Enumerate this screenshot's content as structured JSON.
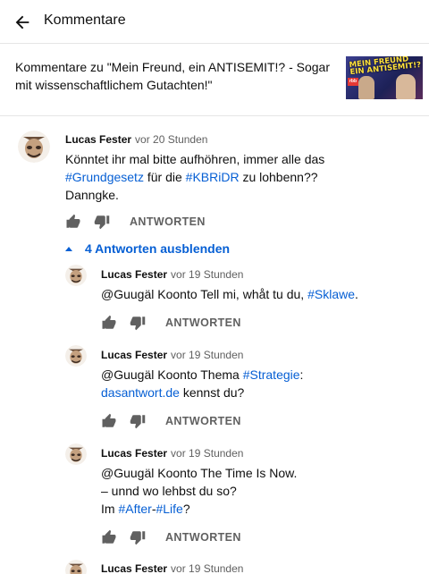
{
  "header": {
    "title": "Kommentare",
    "back_icon": "arrow-back-icon"
  },
  "video": {
    "title": "Kommentare zu \"Mein Freund, ein ANTISEMIT!? - Sogar mit wissenschaftlichem Gutachten!\"",
    "thumbnail_text": "MEIN FREUND EIN ANTISEMIT!?",
    "thumbnail_logo": "rbb"
  },
  "comment": {
    "author": "Lucas Fester",
    "time": "vor 20 Stunden",
    "text_1": "Könntet ihr mal bitte aufhöhren, immer alle das",
    "tag_1": "#Grundgesetz",
    "text_2": " für die ",
    "tag_2": "#KBRiDR",
    "text_3": " zu lohbenn??",
    "text_4": "Danngke.",
    "reply_label": "ANTWORTEN"
  },
  "replies_toggle": "4 Antworten ausblenden",
  "replies": [
    {
      "author": "Lucas Fester",
      "time": "vor 19 Stunden",
      "prefix": " @Guugäl Koonto  Tell mi, whåt tu du, ",
      "tag": "#Sklawe",
      "suffix": ".",
      "reply_label": "ANTWORTEN"
    },
    {
      "author": "Lucas Fester",
      "time": "vor 19 Stunden",
      "prefix": " @Guugäl Koonto  Thema ",
      "tag": "#Strategie",
      "suffix": ":",
      "link": "dasantwort.de",
      "link_suffix": " kennst du?",
      "reply_label": "ANTWORTEN"
    },
    {
      "author": "Lucas Fester",
      "time": "vor 19 Stunden",
      "line_1": " @Guugäl Koonto  The Time Is Now.",
      "line_2": "– unnd wo lehbst du so?",
      "line_3_prefix": "Im ",
      "tag_1": "#After",
      "dash": "-",
      "tag_2": "#Life",
      "line_3_suffix": "?",
      "reply_label": "ANTWORTEN"
    },
    {
      "author": "Lucas Fester",
      "time": "vor 19 Stunden"
    }
  ],
  "colors": {
    "link": "#065fd4",
    "muted": "#606060",
    "text": "#0f0f0f",
    "divider": "#e5e5e5"
  }
}
